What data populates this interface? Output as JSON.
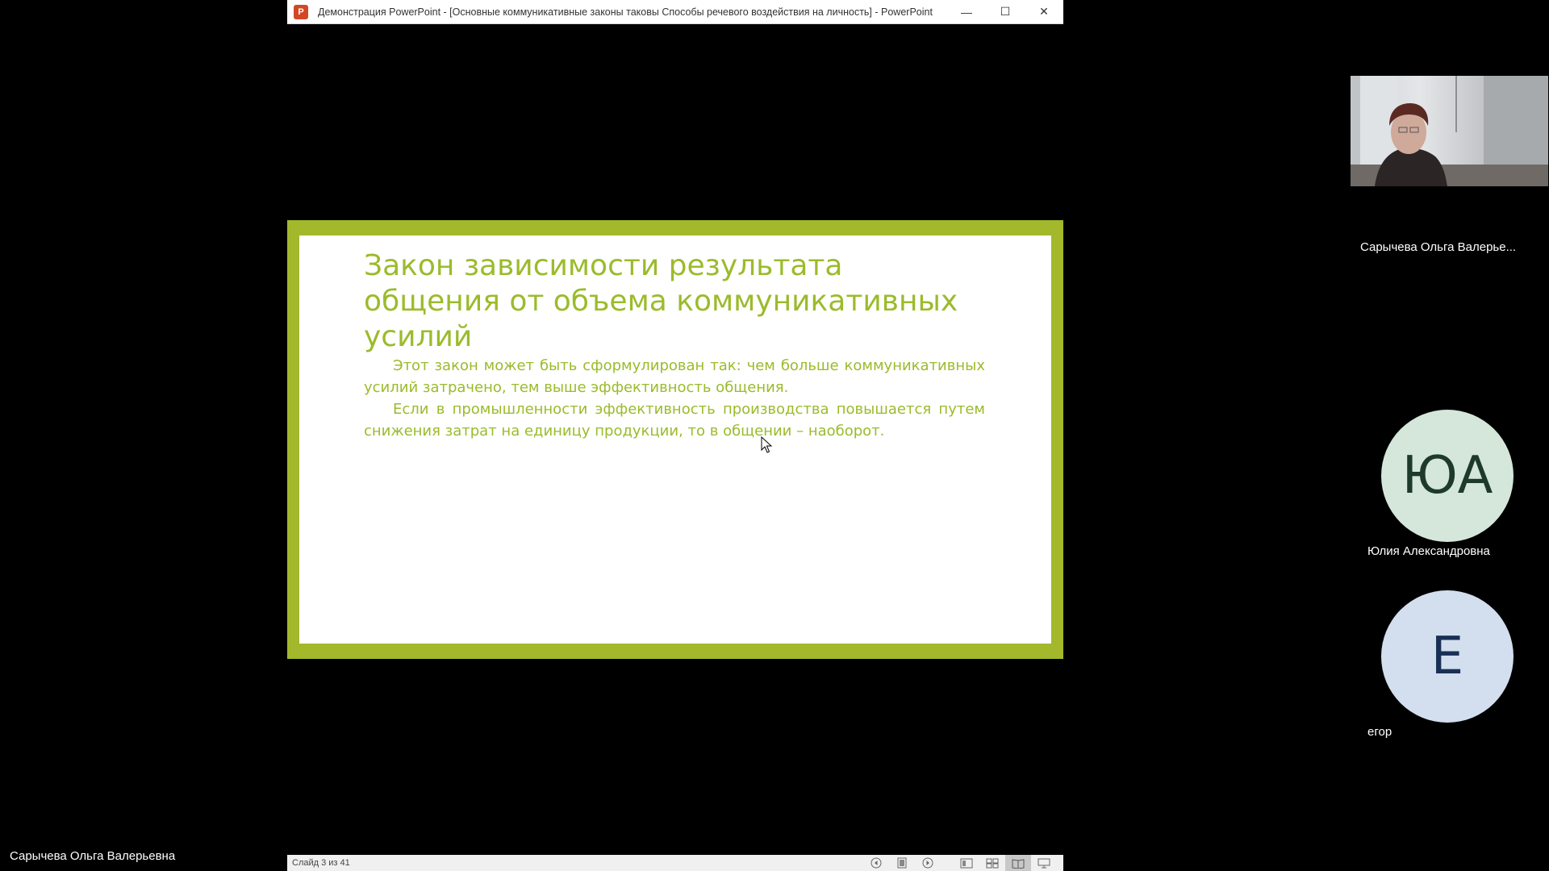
{
  "window": {
    "app_logo": "P",
    "title": "Демонстрация PowerPoint - [Основные коммуникативные законы таковы Способы речевого воздействия на личность] - PowerPoint",
    "minimize_glyph": "—",
    "maximize_glyph": "☐",
    "close_glyph": "✕"
  },
  "slide": {
    "title": "Закон зависимости результата общения от объема коммуникативных усилий",
    "paragraphs": [
      "Этот закон может быть сформулирован так: чем больше коммуникативных усилий затрачено, тем выше эффективность общения.",
      "Если в промышленности эффективность производства повышается путем снижения затрат на единицу продукции, то в общении – наоборот."
    ],
    "accent_color": "#a3b82a"
  },
  "statusbar": {
    "slide_counter": "Слайд 3 из 41",
    "icons": [
      "prev-icon",
      "notes-icon",
      "next-icon",
      "normal-view-icon",
      "sorter-view-icon",
      "reading-view-icon",
      "slideshow-icon"
    ]
  },
  "participants": {
    "presenter_label": "Сарычева Ольга Валерьевна",
    "video_name": "Сарычева Ольга Валерье...",
    "others": [
      {
        "initials": "ЮА",
        "name": "Юлия Александровна"
      },
      {
        "initials": "Е",
        "name": "егор"
      }
    ]
  }
}
